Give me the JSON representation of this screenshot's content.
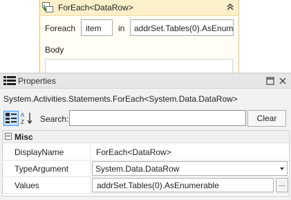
{
  "designer": {
    "activity_title": "ForEach<DataRow>",
    "foreach_label": "Foreach",
    "item_value": "item",
    "in_label": "in",
    "expression_value": "addrSet.Tables(0).AsEnum",
    "body_label": "Body",
    "icons": {
      "activity": "foreach-activity-icon",
      "collapse": "double-chevron-up-icon"
    },
    "colors": {
      "header_bg": "#fbf0c9",
      "border": "#e5c365"
    }
  },
  "properties": {
    "panel_title": "Properties",
    "type_name": "System.Activities.Statements.ForEach<System.Data.DataRow>",
    "search_label": "Search:",
    "search_value": "",
    "clear_label": "Clear",
    "category": "Misc",
    "rows": [
      {
        "name": "DisplayName",
        "value": "ForEach<DataRow>"
      },
      {
        "name": "TypeArgument",
        "value": "System.Data.DataRow"
      },
      {
        "name": "Values",
        "value": "addrSet.Tables(0).AsEnumerable"
      }
    ],
    "ellipsis_label": "...",
    "icons": {
      "panel": "properties-list-icon",
      "restore": "restore-window-icon",
      "close": "close-icon",
      "categorized": "categorized-view-icon",
      "alphabetical": "sort-alphabetical-icon",
      "dropdown": "dropdown-arrow-icon"
    },
    "colors": {
      "accent": "#3399ff"
    }
  }
}
